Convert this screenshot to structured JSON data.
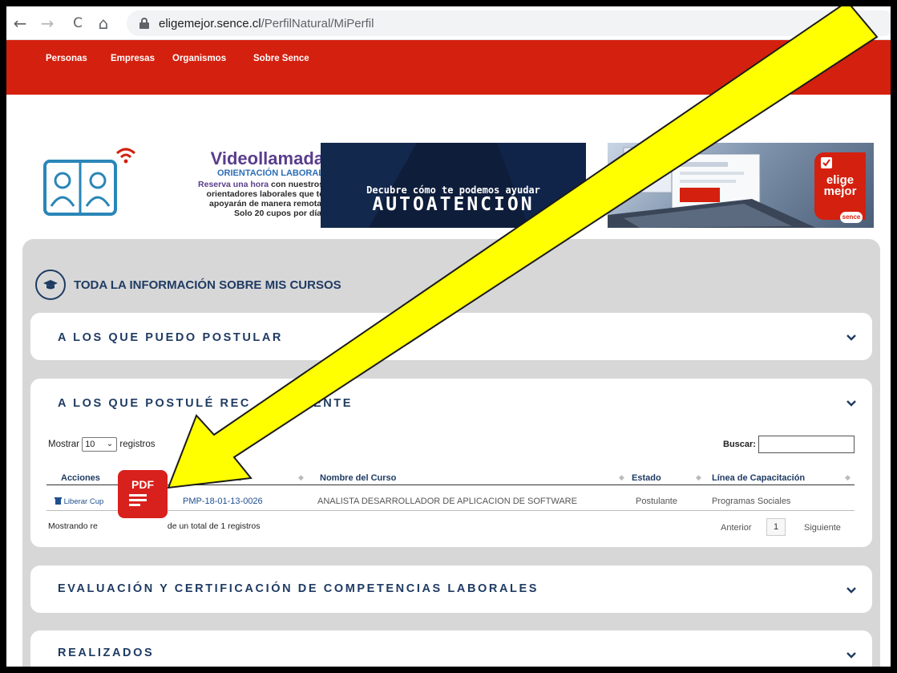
{
  "browser": {
    "back": "←",
    "forward": "→",
    "reload": "C",
    "home": "⌂",
    "url_domain": "eligemejor.sence.cl",
    "url_path": "/PerfilNatural/MiPerfil"
  },
  "nav": {
    "items": [
      "Personas",
      "Empresas",
      "Organismos",
      "Sobre Sence"
    ]
  },
  "banners": {
    "video": {
      "title": "Videollamada",
      "subtitle": "ORIENTACIÓN LABORAL",
      "line1_highlight": "Reserva una hora",
      "line1_rest": " con nuestros",
      "line2": "orientadores laborales que te",
      "line3": "apoyarán de manera remota.",
      "line4": "Solo 20 cupos por día."
    },
    "auto": {
      "subtitle": "Decubre cómo te podemos ayudar",
      "title": "AUTOATENCIÓN"
    },
    "elige": {
      "word1": "elige",
      "word2": "mejor",
      "sence": "sence"
    }
  },
  "main": {
    "section_title": "TODA LA INFORMACIÓN SOBRE MIS CURSOS",
    "cards": {
      "puedo": "A LOS QUE PUEDO POSTULAR",
      "postule": "A LOS QUE POSTULÉ REC",
      "postule_tail": "ENTE",
      "evaluacion": "EVALUACIÓN Y CERTIFICACIÓN DE COMPETENCIAS LABORALES",
      "realizados": "REALIZADOS"
    },
    "table": {
      "show_label": "Mostrar",
      "show_value": "10",
      "records_label": "registros",
      "search_label": "Buscar:",
      "columns": {
        "acciones": "Acciones",
        "codigo": "o Curso",
        "nombre": "Nombre del Curso",
        "estado": "Estado",
        "linea": "Línea de Capacitación"
      },
      "row": {
        "accion": "Liberar Cup",
        "codigo": "PMP-18-01-13-0026",
        "nombre": "ANALISTA DESARROLLADOR DE APLICACION DE SOFTWARE",
        "estado": "Postulante",
        "linea": "Programas Sociales"
      },
      "info_start": "Mostrando re",
      "info_end": "de un total de 1 registros",
      "prev": "Anterior",
      "page": "1",
      "next": "Siguiente"
    },
    "pdf_label": "PDF"
  },
  "colors": {
    "nav_red": "#d4200e",
    "heading_blue": "#1f3b63",
    "arrow_yellow": "#ffff00"
  }
}
